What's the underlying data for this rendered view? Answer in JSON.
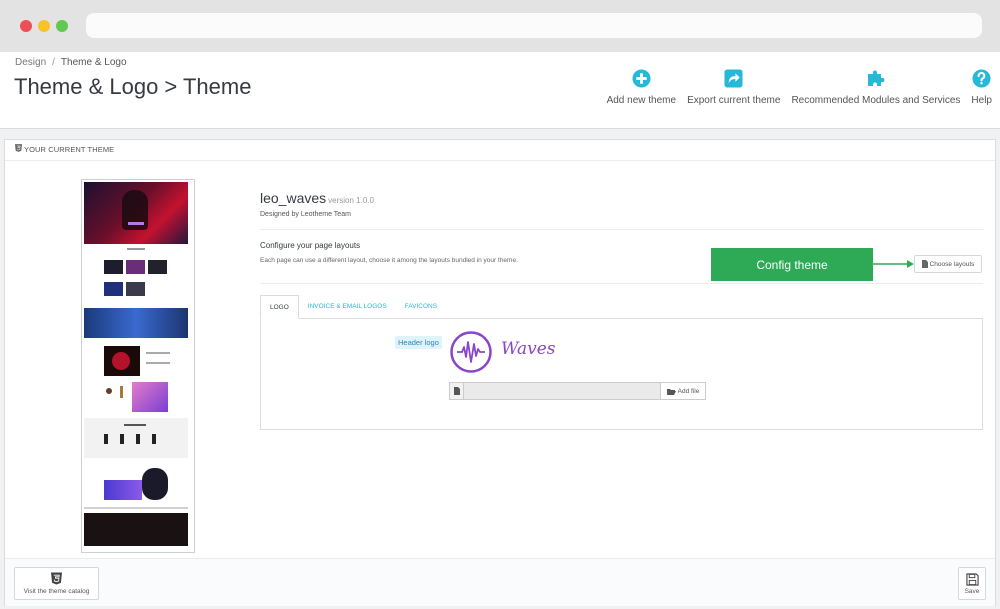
{
  "breadcrumb": {
    "root": "Design",
    "sep": "/",
    "current": "Theme & Logo"
  },
  "page_title": "Theme & Logo > Theme",
  "toolbar": {
    "add_theme": "Add new theme",
    "export_theme": "Export current theme",
    "recommended": "Recommended Modules and Services",
    "help": "Help"
  },
  "panel": {
    "heading": "YOUR CURRENT THEME"
  },
  "theme": {
    "name": "leo_waves",
    "version": "version 1.0.0",
    "author": "Designed by Leotheme Team"
  },
  "layouts": {
    "title": "Configure your page layouts",
    "description": "Each page can use a different layout, choose it among the layouts bundled in your theme.",
    "choose_label": "Choose layouts"
  },
  "callout": {
    "label": "Config theme"
  },
  "tabs": [
    {
      "label": "LOGO",
      "active": true
    },
    {
      "label": "INVOICE & EMAIL LOGOS",
      "active": false
    },
    {
      "label": "FAVICONS",
      "active": false
    }
  ],
  "logo": {
    "label": "Header logo",
    "brand_text": "Waves",
    "add_file": "Add file"
  },
  "footer": {
    "visit_catalog": "Visit the theme catalog",
    "save": "Save"
  },
  "colors": {
    "accent": "#25b9d7",
    "callout": "#2eaa57",
    "brand_purple": "#8a45c9"
  }
}
